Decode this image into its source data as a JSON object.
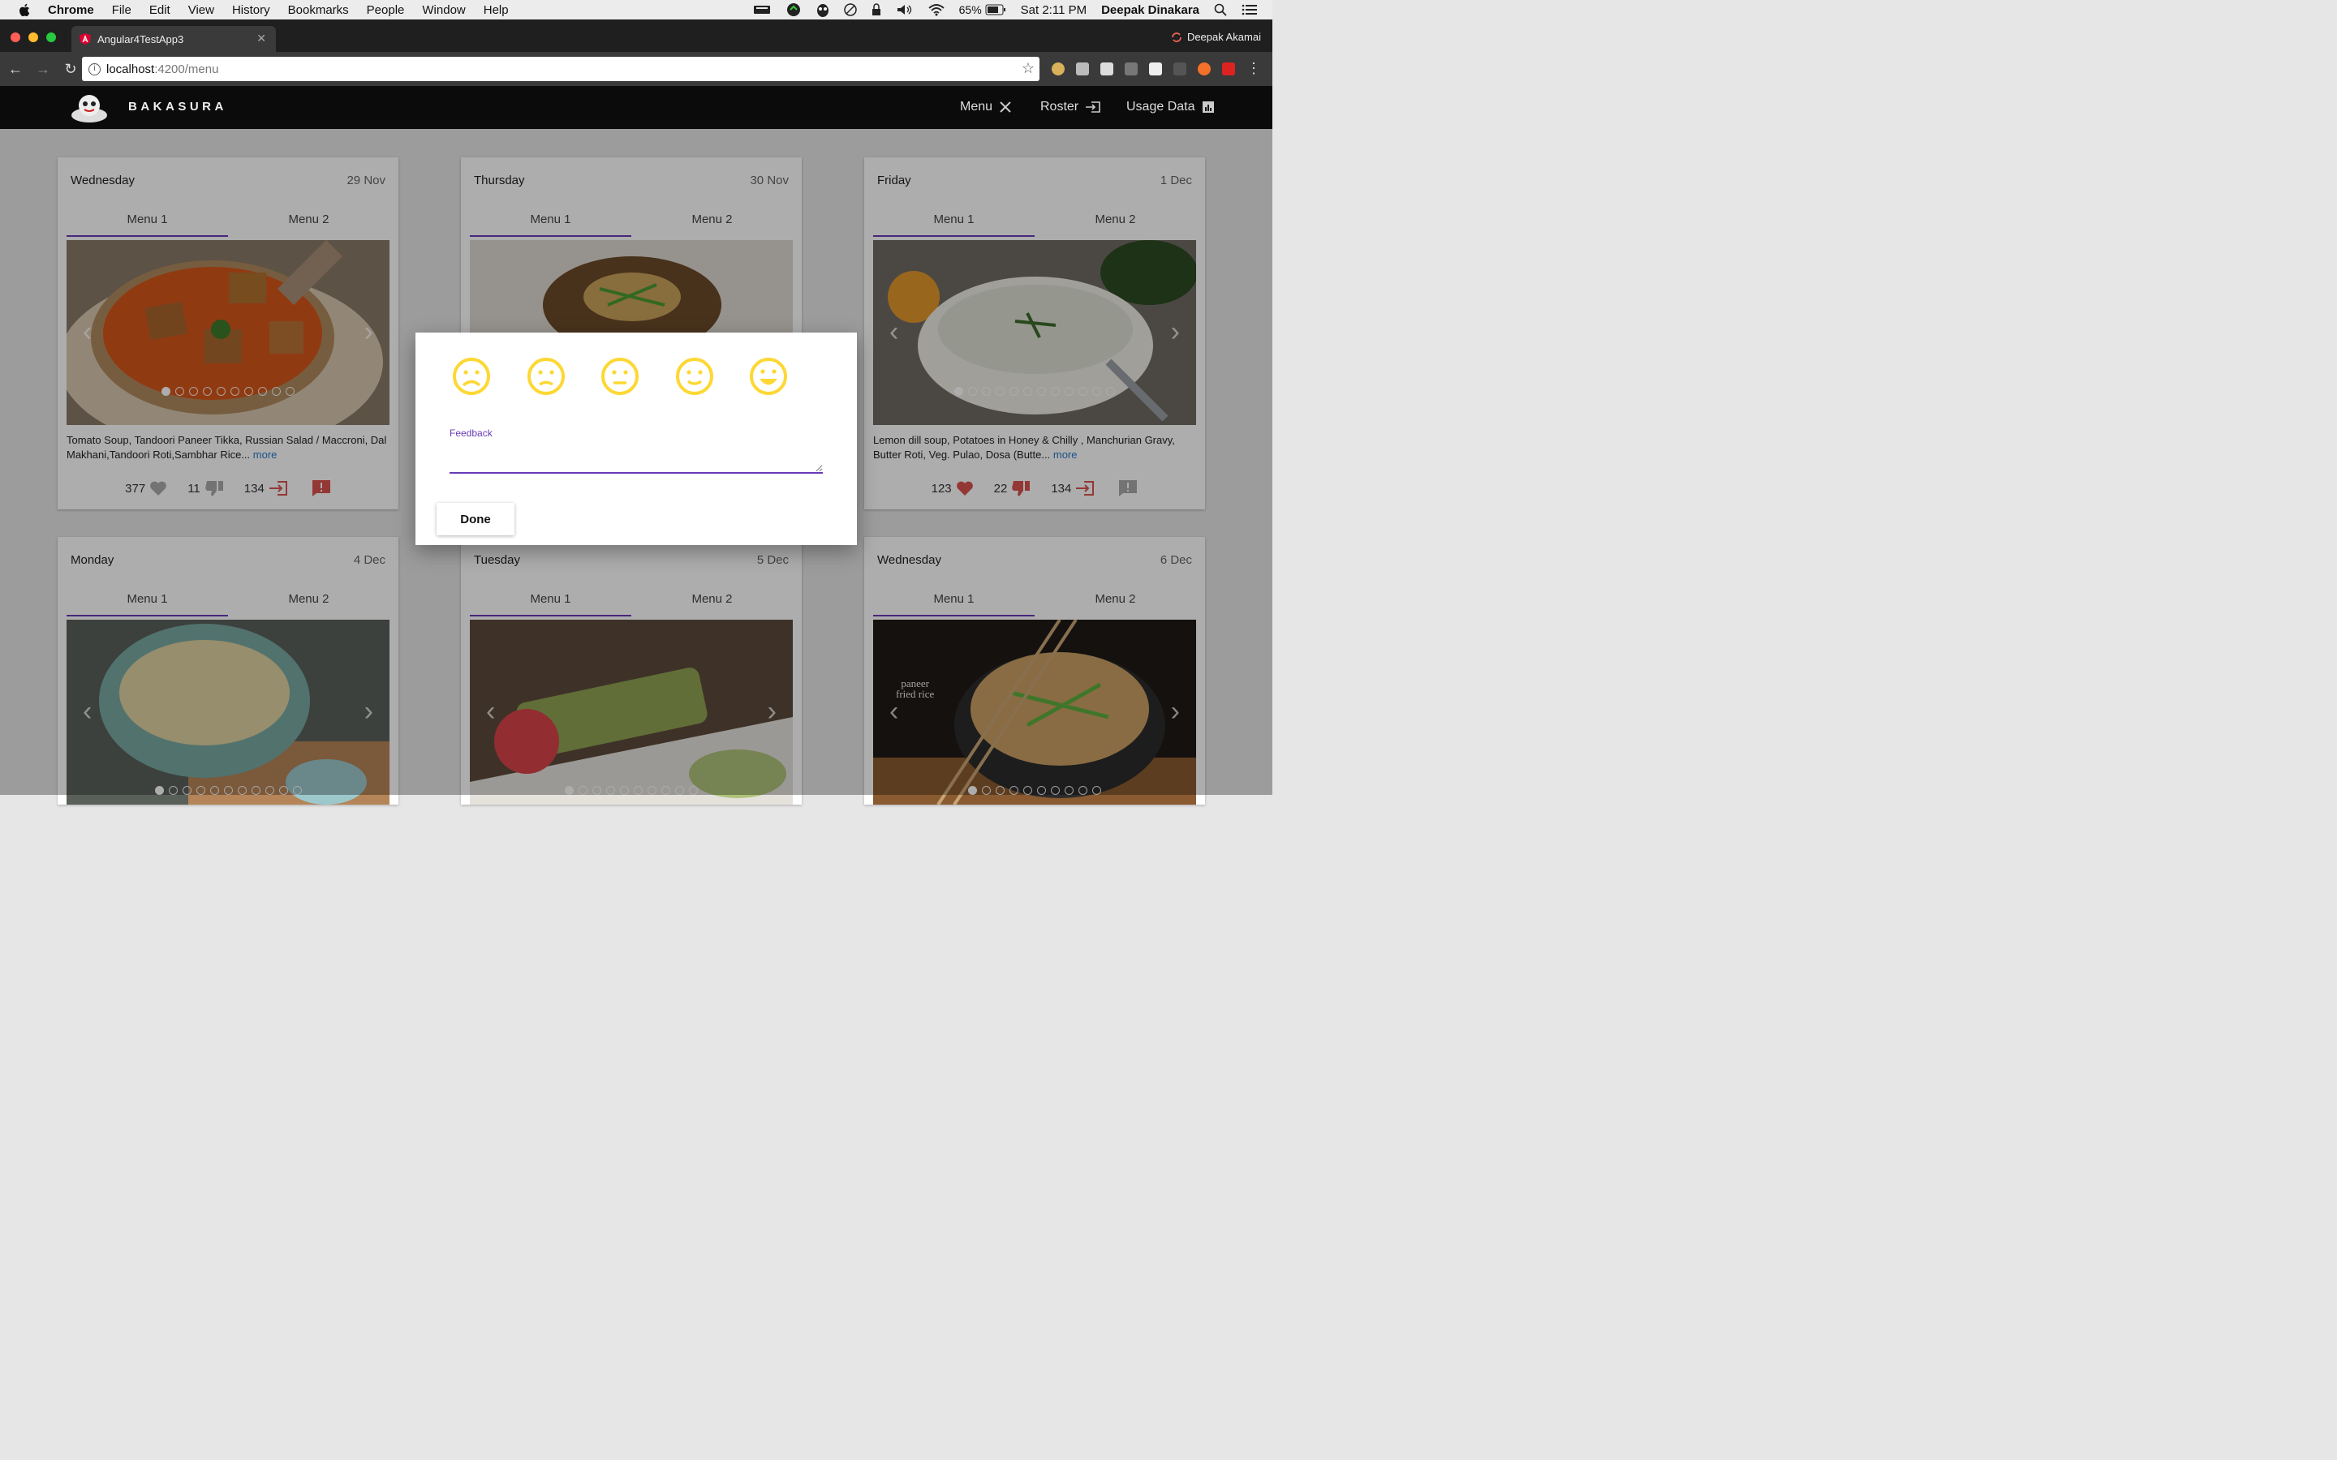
{
  "mac_menubar": {
    "app_name": "Chrome",
    "items": [
      "File",
      "Edit",
      "View",
      "History",
      "Bookmarks",
      "People",
      "Window",
      "Help"
    ],
    "battery": "65%",
    "clock": "Sat 2:11 PM",
    "user": "Deepak Dinakara"
  },
  "browser": {
    "tab_title": "Angular4TestApp3",
    "profile_name": "Deepak Akamai",
    "url_host": "localhost",
    "url_path": ":4200/menu"
  },
  "app": {
    "brand": "BAKASURA",
    "nav": [
      {
        "label": "Menu",
        "icon": "fork-knife-icon"
      },
      {
        "label": "Roster",
        "icon": "sign-in-icon"
      },
      {
        "label": "Usage Data",
        "icon": "bar-chart-icon"
      }
    ]
  },
  "cards": [
    {
      "day": "Wednesday",
      "date": "29 Nov",
      "tabs": [
        "Menu 1",
        "Menu 2"
      ],
      "description": "Tomato Soup, Tandoori Paneer Tikka, Russian Salad / Maccroni, Dal Makhani,Tandoori Roti,Sambhar Rice...",
      "more": "more",
      "likes": "377",
      "dislikes": "11",
      "checkins": "134",
      "photo": "tomato-soup",
      "dots_total": 10,
      "dots_active": 1
    },
    {
      "day": "Thursday",
      "date": "30 Nov",
      "tabs": [
        "Menu 1",
        "Menu 2"
      ],
      "photo": "noodle-soup"
    },
    {
      "day": "Friday",
      "date": "1 Dec",
      "tabs": [
        "Menu 1",
        "Menu 2"
      ],
      "description": "Lemon dill soup, Potatoes in Honey & Chilly , Manchurian Gravy, Butter Roti, Veg. Pulao, Dosa (Butte...",
      "more": "more",
      "likes": "123",
      "dislikes": "22",
      "checkins": "134",
      "photo": "dill-soup",
      "dots_total": 12,
      "dots_active": 1
    },
    {
      "day": "Monday",
      "date": "4 Dec",
      "tabs": [
        "Menu 1",
        "Menu 2"
      ],
      "photo": "cream-soup",
      "dots_total": 11,
      "dots_active": 1
    },
    {
      "day": "Tuesday",
      "date": "5 Dec",
      "tabs": [
        "Menu 1",
        "Menu 2"
      ],
      "photo": "hara-bhara-kebab",
      "dots_total": 10,
      "dots_active": 1
    },
    {
      "day": "Wednesday",
      "date": "6 Dec",
      "tabs": [
        "Menu 1",
        "Menu 2"
      ],
      "photo": "paneer-fried-rice",
      "photo_caption": "paneer\nfried rice",
      "dots_total": 10,
      "dots_active": 1
    }
  ],
  "dialog": {
    "faces": [
      "very-sad-face-icon",
      "sad-face-icon",
      "neutral-face-icon",
      "happy-face-icon",
      "very-happy-face-icon"
    ],
    "feedback_label": "Feedback",
    "feedback_value": "",
    "done_label": "Done",
    "accent": "#673ab7",
    "face_color": "#fdd835"
  }
}
